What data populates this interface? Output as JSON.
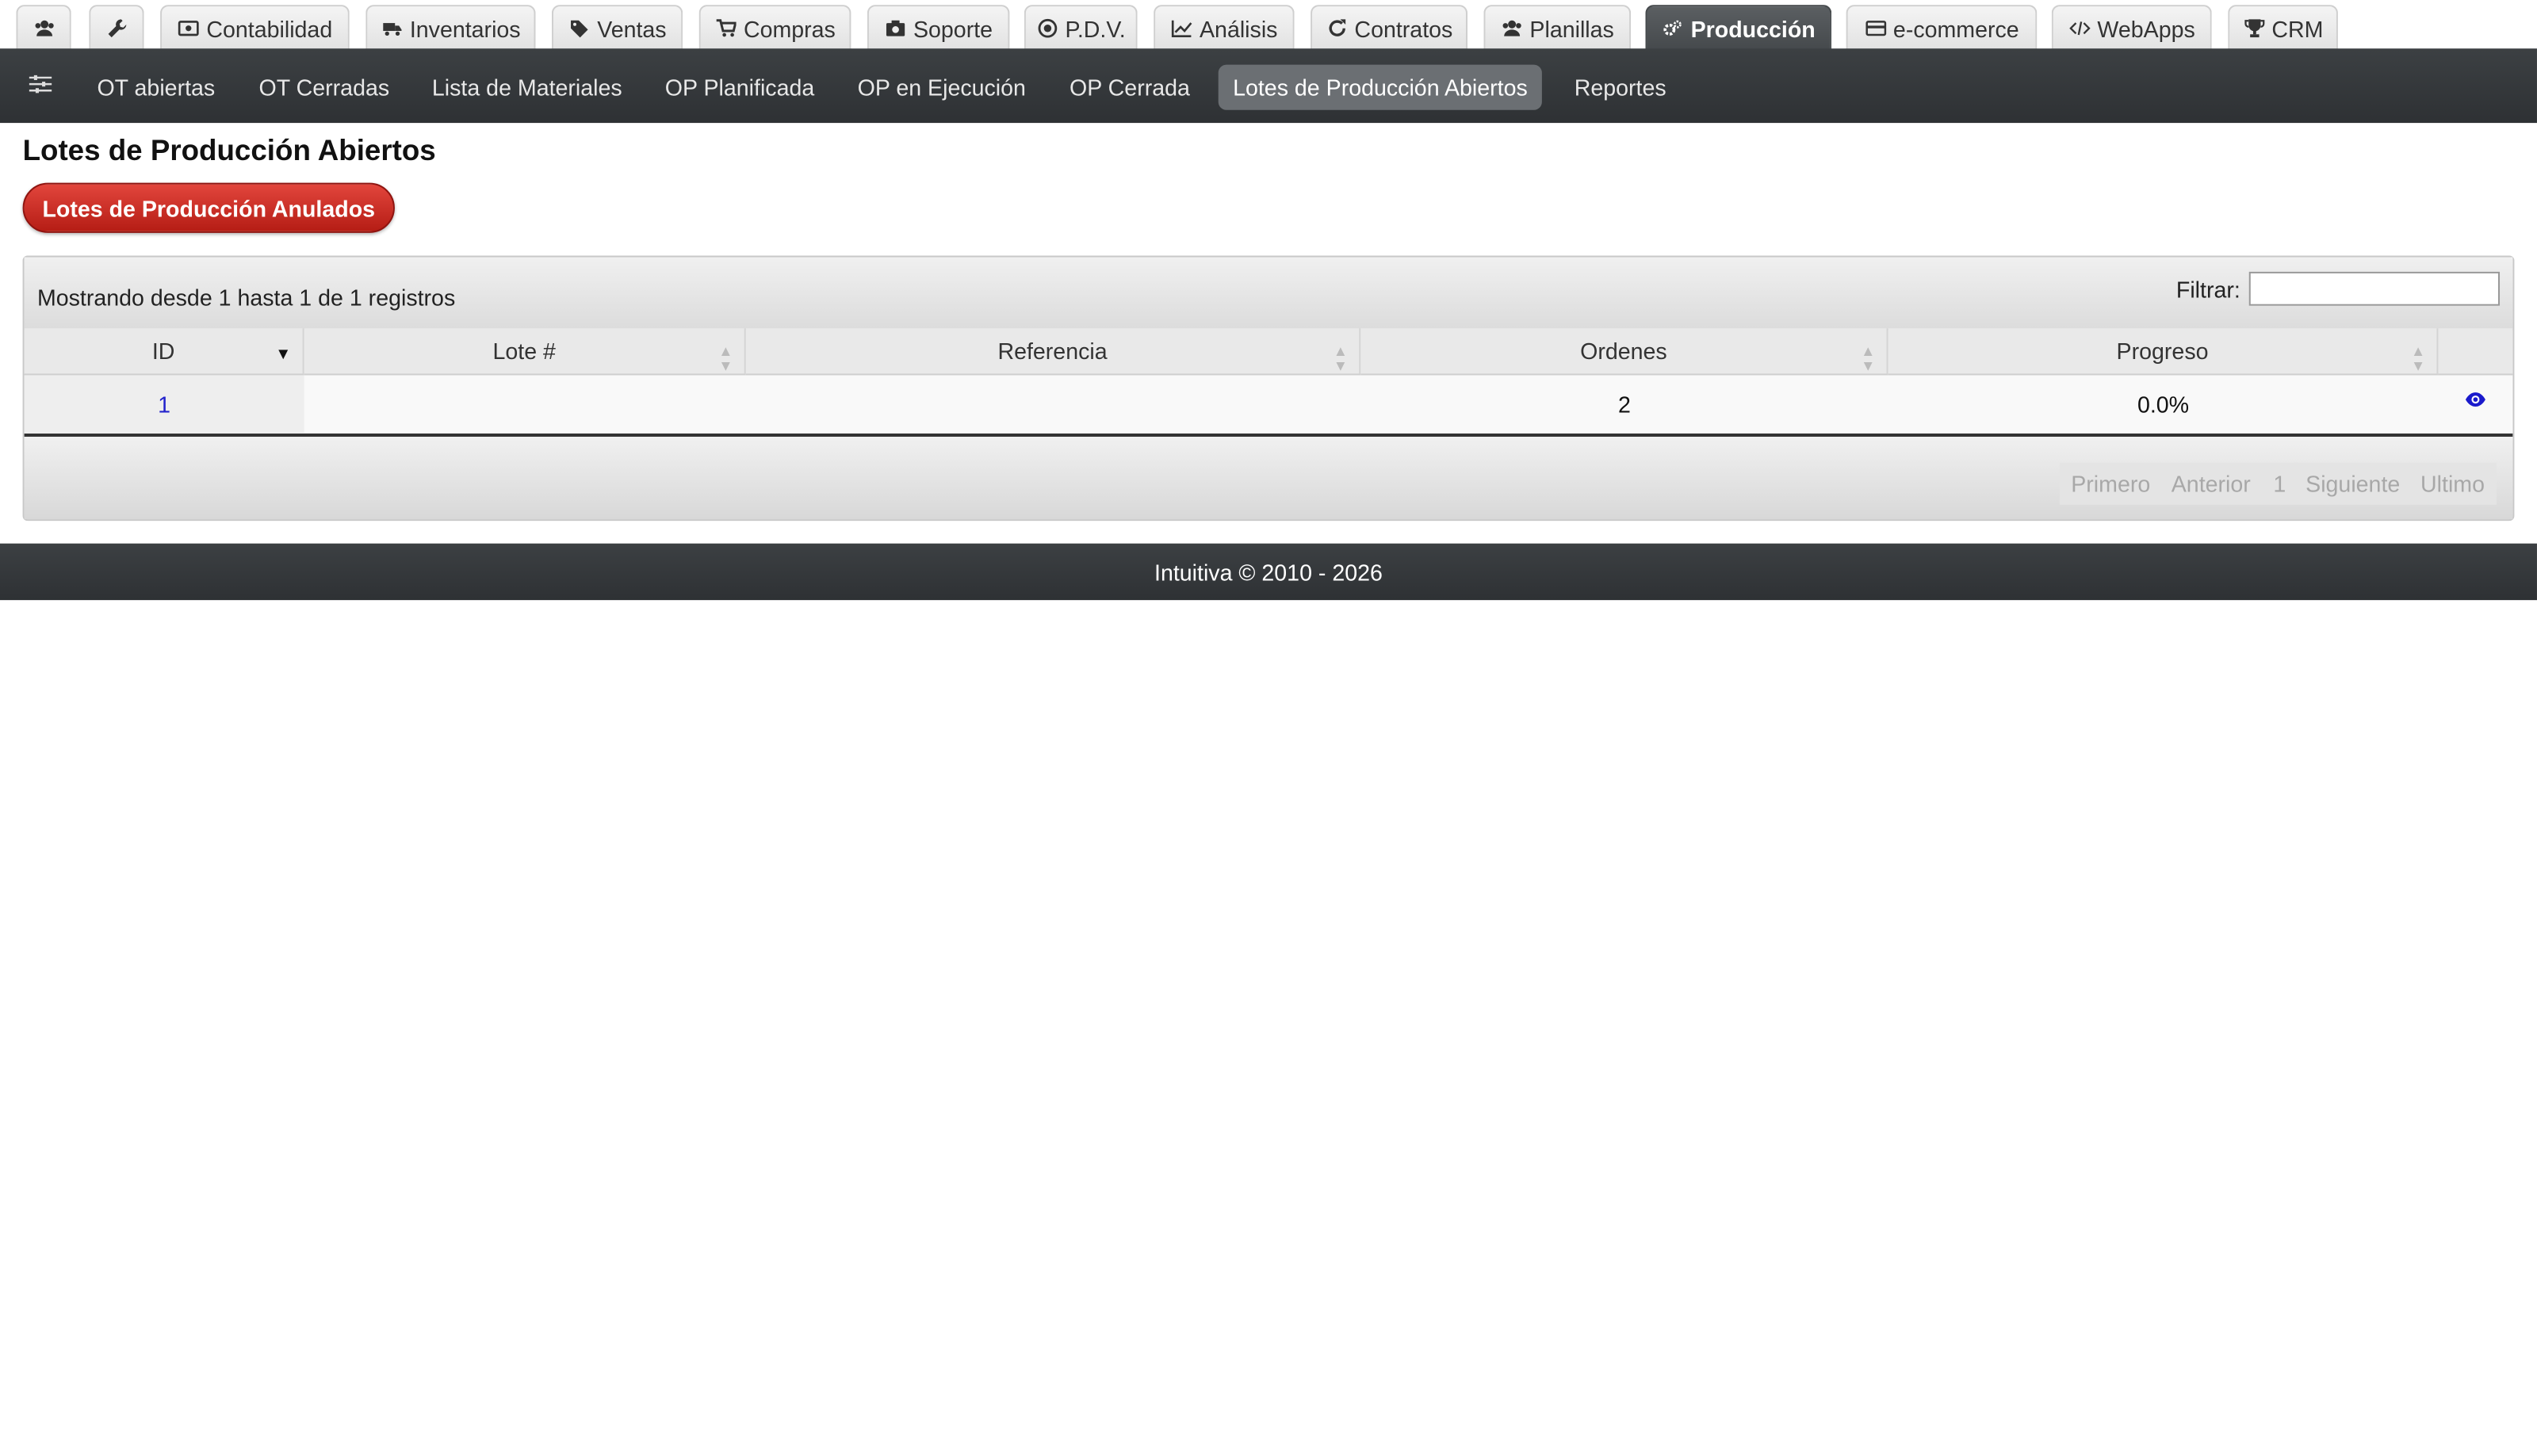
{
  "top_tabs": [
    {
      "icon": "users-icon",
      "label": ""
    },
    {
      "icon": "wrench-icon",
      "label": ""
    },
    {
      "icon": "money-icon",
      "label": "Contabilidad"
    },
    {
      "icon": "truck-icon",
      "label": "Inventarios"
    },
    {
      "icon": "tags-icon",
      "label": "Ventas"
    },
    {
      "icon": "cart-icon",
      "label": "Compras"
    },
    {
      "icon": "camera-icon",
      "label": "Soporte"
    },
    {
      "icon": "target-icon",
      "label": "P.D.V."
    },
    {
      "icon": "chart-line-icon",
      "label": "Análisis"
    },
    {
      "icon": "refresh-icon",
      "label": "Contratos"
    },
    {
      "icon": "users-icon",
      "label": "Planillas"
    },
    {
      "icon": "cogs-icon",
      "label": "Producción",
      "active": true
    },
    {
      "icon": "credit-card-icon",
      "label": "e-commerce"
    },
    {
      "icon": "code-icon",
      "label": "WebApps"
    },
    {
      "icon": "trophy-icon",
      "label": "CRM"
    }
  ],
  "subnav": {
    "menu_icon": "sliders-icon",
    "items": [
      "OT abiertas",
      "OT Cerradas",
      "Lista de Materiales",
      "OP Planificada",
      "OP en Ejecución",
      "OP Cerrada",
      "Lotes de Producción Abiertos",
      "Reportes"
    ],
    "active_index": 6
  },
  "page": {
    "title": "Lotes de Producción Abiertos",
    "button_label": "Lotes de Producción Anulados"
  },
  "table": {
    "info": "Mostrando desde 1 hasta 1 de 1 registros",
    "filter_label": "Filtrar:",
    "filter_value": "",
    "columns": [
      "ID",
      "Lote #",
      "Referencia",
      "Ordenes",
      "Progreso",
      ""
    ],
    "rows": [
      {
        "id": "1",
        "lote": "",
        "referencia": "",
        "ordenes": "2",
        "progreso": "0.0%",
        "action_icon": "eye-icon"
      }
    ],
    "pagination": [
      "Primero",
      "Anterior",
      "1",
      "Siguiente",
      "Ultimo"
    ]
  },
  "footer": {
    "text": "Intuitiva © 2010 - 2026"
  },
  "colors": {
    "accent_active_tab": "#4e5255",
    "danger_button": "#c62a22",
    "link": "#2222cc"
  }
}
